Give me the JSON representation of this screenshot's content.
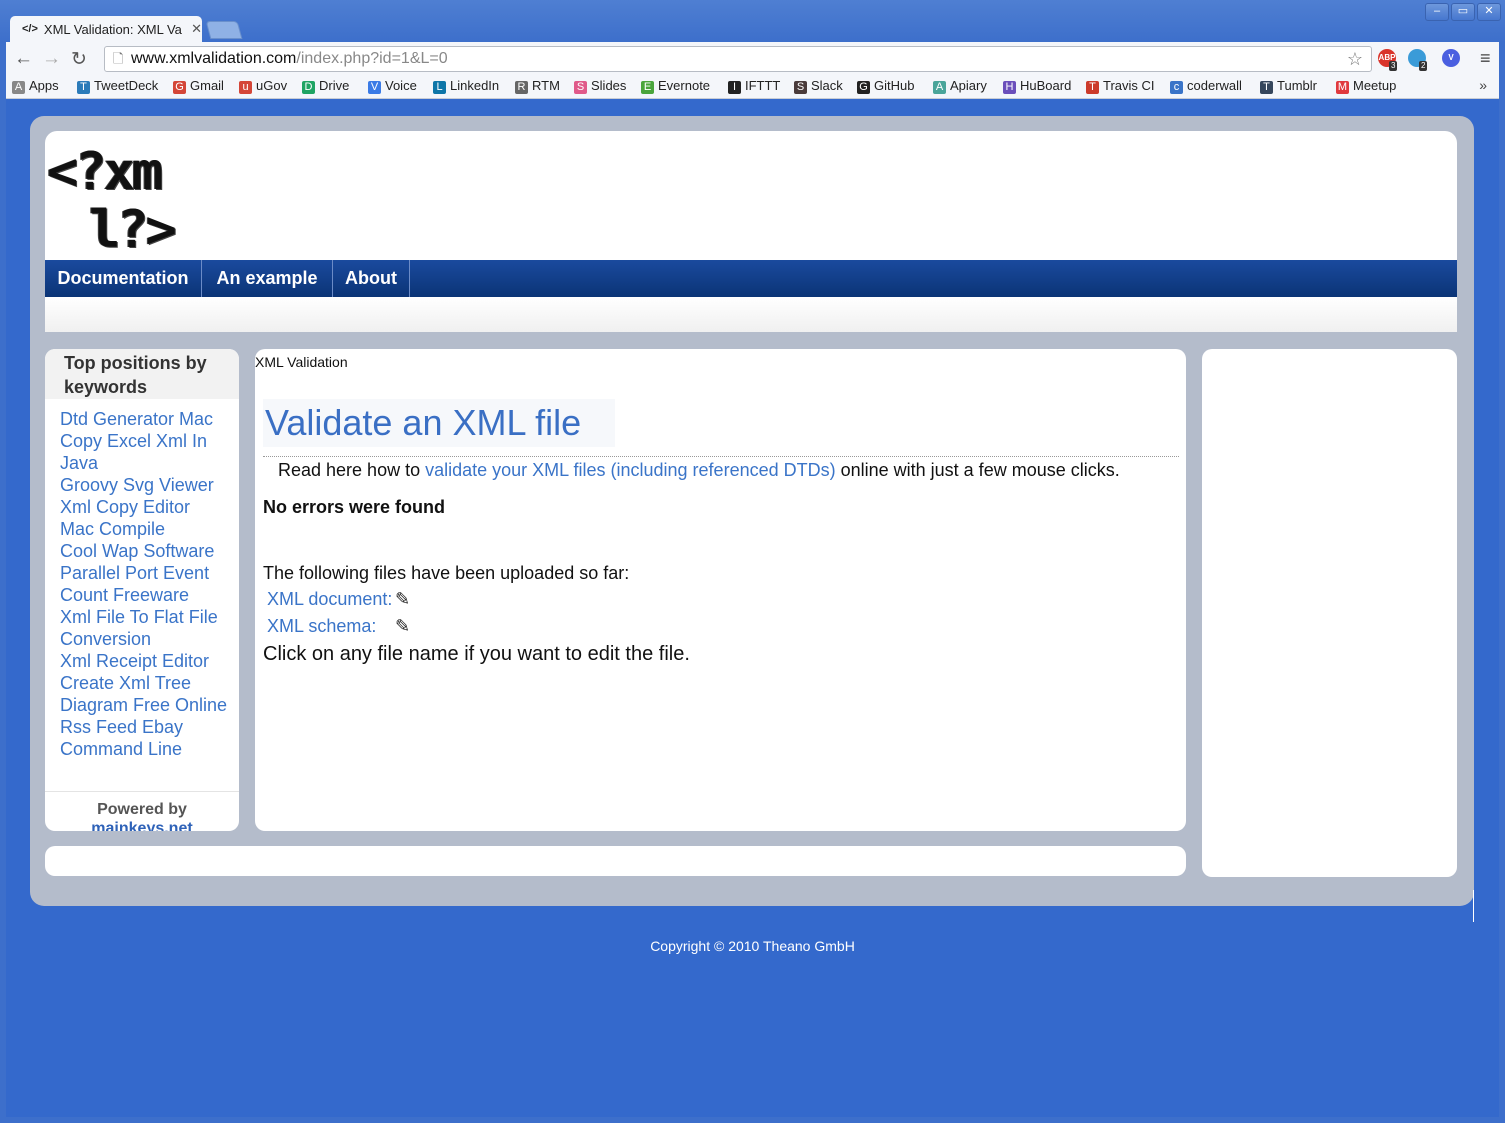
{
  "browser": {
    "tab_title": "XML Validation: XML Va",
    "tab_favicon": "</>",
    "url_host": "www.xmlvalidation.com",
    "url_path": "/index.php?id=1&L=0",
    "extensions": [
      {
        "name": "adblock-icon",
        "label": "ABP",
        "badge": "3",
        "color": "#d9342b"
      },
      {
        "name": "ghostery-icon",
        "label": "",
        "badge": "2",
        "color": "#3a9bd8"
      },
      {
        "name": "extension-v-icon",
        "label": "V",
        "badge": "",
        "color": "#4a5fe0"
      }
    ],
    "bookmarks": [
      {
        "label": "Apps",
        "icon": "apps-icon",
        "color": "#888"
      },
      {
        "label": "TweetDeck",
        "icon": "tweetdeck-icon",
        "color": "#2b7bb9"
      },
      {
        "label": "Gmail",
        "icon": "gmail-icon",
        "color": "#d44638"
      },
      {
        "label": "uGov",
        "icon": "ugov-icon",
        "color": "#d44638"
      },
      {
        "label": "Drive",
        "icon": "drive-icon",
        "color": "#1fa463"
      },
      {
        "label": "Voice",
        "icon": "voice-icon",
        "color": "#3b7be6"
      },
      {
        "label": "LinkedIn",
        "icon": "linkedin-icon",
        "color": "#0e76a8"
      },
      {
        "label": "RTM",
        "icon": "rtm-icon",
        "color": "#666"
      },
      {
        "label": "Slides",
        "icon": "slides-icon",
        "color": "#e05a8a"
      },
      {
        "label": "Evernote",
        "icon": "evernote-icon",
        "color": "#4aa53c"
      },
      {
        "label": "IFTTT",
        "icon": "ifttt-icon",
        "color": "#222"
      },
      {
        "label": "Slack",
        "icon": "slack-icon",
        "color": "#4a3b3b"
      },
      {
        "label": "GitHub",
        "icon": "github-icon",
        "color": "#222"
      },
      {
        "label": "Apiary",
        "icon": "apiary-icon",
        "color": "#4aa59a"
      },
      {
        "label": "HuBoard",
        "icon": "huboard-icon",
        "color": "#6b4fbb"
      },
      {
        "label": "Travis CI",
        "icon": "travis-icon",
        "color": "#cc3b2b"
      },
      {
        "label": "coderwall",
        "icon": "coderwall-icon",
        "color": "#3a74c8"
      },
      {
        "label": "Tumblr",
        "icon": "tumblr-icon",
        "color": "#35465c"
      },
      {
        "label": "Meetup",
        "icon": "meetup-icon",
        "color": "#e0393e"
      }
    ],
    "bookmarks_more": "»"
  },
  "site": {
    "logo_line1": "<?xm",
    "logo_line2": "l?>",
    "nav": [
      "Documentation",
      "An example",
      "About"
    ],
    "sidebar_title": "Top positions by keywords",
    "keywords": [
      "Dtd Generator Mac",
      "Copy Excel Xml In Java",
      "Groovy Svg Viewer",
      "Xml Copy Editor",
      "Mac Compile",
      "Cool Wap Software",
      "Parallel Port Event Count Freeware",
      "Xml File To Flat File Conversion",
      "Xml Receipt Editor",
      "Create Xml Tree Diagram Free Online",
      "Rss Feed Ebay Command Line"
    ],
    "powered_by": "Powered by",
    "powered_link": "mainkeys.net",
    "breadcrumb": "XML Validation",
    "heading": "Validate an XML file",
    "intro_before": "Read here how to ",
    "intro_link": "validate your XML files (including referenced DTDs)",
    "intro_after": " online with just a few mouse clicks.",
    "result": "No errors were found",
    "uploaded_label": "The following files have been uploaded so far:",
    "file_document": "XML document:",
    "file_schema": "XML schema:",
    "edit_hint": "Click on any file name if you want to edit the file.",
    "copyright": "Copyright © 2010 Theano GmbH"
  }
}
